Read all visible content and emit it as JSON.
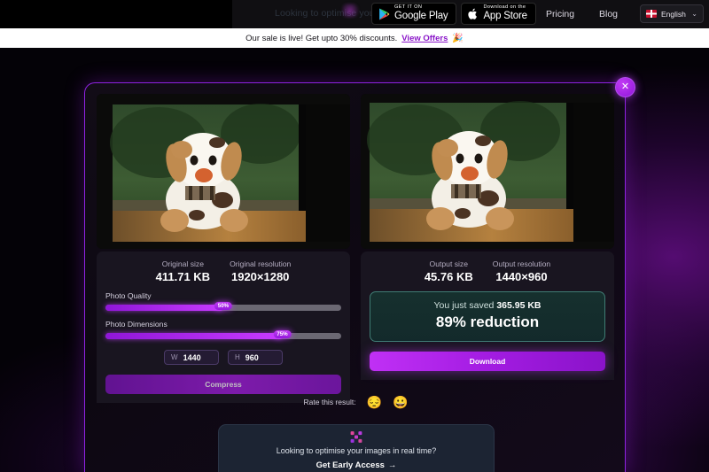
{
  "nav": {
    "ghost_text": "Looking to optimise your i",
    "badges": [
      {
        "small": "GET IT ON",
        "big": "Google Play",
        "icon": "google-play-icon"
      },
      {
        "small": "Download on the",
        "big": "App Store",
        "icon": "apple-icon"
      }
    ],
    "links": [
      {
        "label": "Pricing"
      },
      {
        "label": "Blog"
      }
    ],
    "language": {
      "label": "English",
      "flag": "uk-flag-icon",
      "chevron": "⌄"
    }
  },
  "banner": {
    "text": "Our sale is live! Get upto 30% discounts.",
    "link": "View Offers",
    "emoji": "🎉"
  },
  "modal": {
    "close_label": "✕",
    "left": {
      "stats": [
        {
          "label": "Original size",
          "value": "411.71 KB"
        },
        {
          "label": "Original resolution",
          "value": "1920×1280"
        }
      ],
      "quality": {
        "label": "Photo Quality",
        "value": 50,
        "badge": "50%"
      },
      "dimensions": {
        "label": "Photo Dimensions",
        "value": 75,
        "badge": "75%"
      },
      "width_field": {
        "key": "W",
        "value": "1440"
      },
      "height_field": {
        "key": "H",
        "value": "960"
      },
      "button": "Compress"
    },
    "right": {
      "stats": [
        {
          "label": "Output size",
          "value": "45.76 KB"
        },
        {
          "label": "Output resolution",
          "value": "1440×960"
        }
      ],
      "saved_prefix": "You just saved ",
      "saved_amount": "365.95 KB",
      "reduction": "89% reduction",
      "button": "Download"
    },
    "rate": {
      "label": "Rate this result:",
      "sad_emoji": "😔",
      "happy_emoji": "😀"
    },
    "promo": {
      "logo": "brand-x-logo-icon",
      "text": "Looking to optimise your images in real time?",
      "cta": "Get Early Access",
      "arrow": "→"
    }
  },
  "colors": {
    "accent_purple": "#a41ee0",
    "border_purple": "#8e22e0",
    "saved_teal": "#3f7d74",
    "banner_link": "#8b17c9"
  }
}
